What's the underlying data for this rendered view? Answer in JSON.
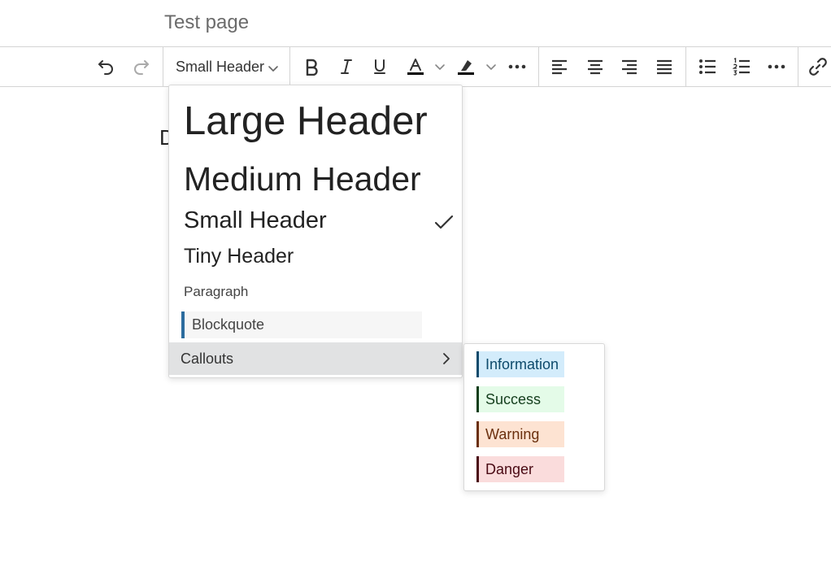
{
  "page": {
    "title": "Test page"
  },
  "toolbar": {
    "block_format_label": "Small Header",
    "buttons": [
      "undo-icon",
      "redo-icon",
      "bold-icon",
      "italic-icon",
      "underline-icon",
      "text-color-icon",
      "highlight-icon",
      "more-icon",
      "align-left-icon",
      "align-center-icon",
      "align-right-icon",
      "align-justify-icon",
      "bullet-list-icon",
      "numbered-list-icon",
      "more-icon",
      "link-icon"
    ],
    "text_color": "#000000",
    "highlight_color": "#000000"
  },
  "document": {
    "visible_text": "D"
  },
  "dropdown": {
    "items": [
      {
        "label": "Large Header"
      },
      {
        "label": "Medium Header"
      },
      {
        "label": "Small Header",
        "selected": true
      },
      {
        "label": "Tiny Header"
      },
      {
        "label": "Paragraph"
      },
      {
        "label": "Blockquote"
      },
      {
        "label": "Callouts",
        "has_submenu": true
      }
    ]
  },
  "callouts_submenu": {
    "items": [
      {
        "label": "Information",
        "bg": "#d3ecfb",
        "accent": "#0d4a6b"
      },
      {
        "label": "Success",
        "bg": "#e4fbe8",
        "accent": "#0f3d1a"
      },
      {
        "label": "Warning",
        "bg": "#fde3d2",
        "accent": "#6a2f0d"
      },
      {
        "label": "Danger",
        "bg": "#fadcdc",
        "accent": "#4a0a14"
      }
    ]
  }
}
